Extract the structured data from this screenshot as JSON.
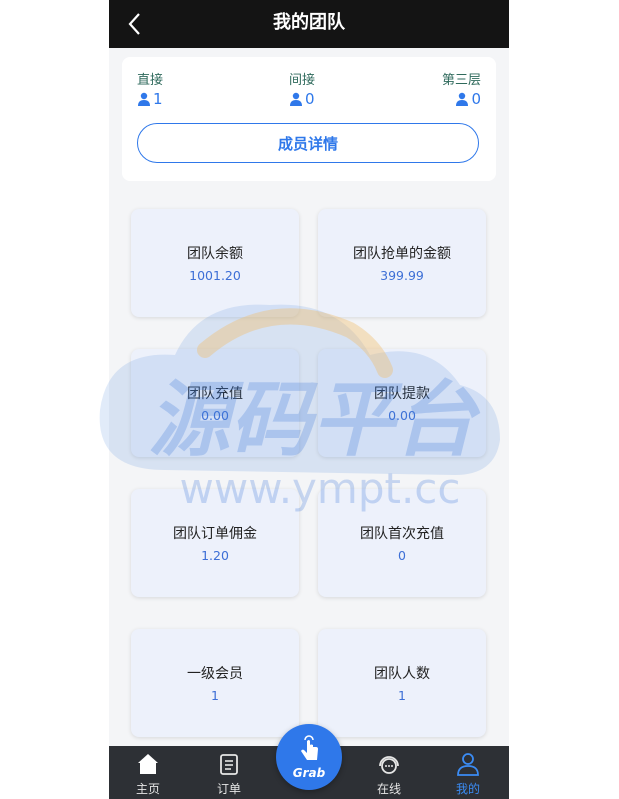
{
  "header": {
    "title": "我的团队"
  },
  "levels": [
    {
      "label": "直接",
      "count": "1"
    },
    {
      "label": "间接",
      "count": "0"
    },
    {
      "label": "第三层",
      "count": "0"
    }
  ],
  "member_button": "成员详情",
  "stats": [
    {
      "label": "团队余额",
      "value": "1001.20"
    },
    {
      "label": "团队抢单的金额",
      "value": "399.99"
    },
    {
      "label": "团队充值",
      "value": "0.00"
    },
    {
      "label": "团队提款",
      "value": "0.00"
    },
    {
      "label": "团队订单佣金",
      "value": "1.20"
    },
    {
      "label": "团队首次充值",
      "value": "0"
    },
    {
      "label": "一级会员",
      "value": "1"
    },
    {
      "label": "团队人数",
      "value": "1"
    }
  ],
  "nav": {
    "home": "主页",
    "orders": "订单",
    "grab": "Grab",
    "online": "在线",
    "mine": "我的"
  },
  "watermark": {
    "brand": "源码平台",
    "url": "www.ympt.cc"
  },
  "colors": {
    "accent": "#2f78ea",
    "header_bg": "#141414",
    "nav_bg": "#2d3035",
    "card_bg": "#edf1fb"
  }
}
